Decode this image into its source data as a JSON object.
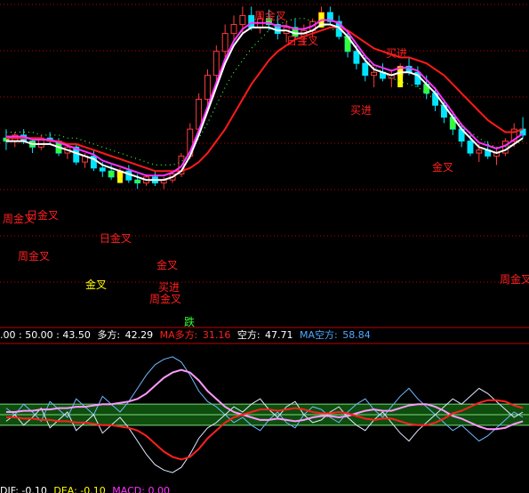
{
  "colors": {
    "background": "#000000",
    "up_candle": "#ff3b3b",
    "down_candle": "#00e5ff",
    "volume_green": "#33ff33",
    "highlight_yellow": "#ffff00",
    "ma_white": "#ffffff",
    "ma_magenta": "#ff33ff",
    "ma_red": "#ff1a1a",
    "dotted_green": "#33ff33",
    "grid_red": "#c00000",
    "label_red": "#ff2020",
    "label_yellow": "#ffff00",
    "osc_white": "#dfe8ff",
    "osc_pink": "#ff99ff",
    "osc_blue": "#6fb8ff",
    "osc_red": "#ff2020",
    "band_fill": "#0e4d0e",
    "band_line": "#7cd97c"
  },
  "signals": {
    "ri_jin_cha": "日金叉",
    "zhou_jin_cha": "周金叉",
    "mai_jin": "买进",
    "jin_cha": "金叉",
    "die": "跌"
  },
  "infobar": {
    "prefix": ".00 : 50.00 : 43.50",
    "duofang_label": "多方:",
    "duofang_value": "42.29",
    "ma_duofang_label": "MA多方:",
    "ma_duofang_value": "31.16",
    "kongfang_label": "空方:",
    "kongfang_value": "47.71",
    "ma_kongfang_label": "MA空方:",
    "ma_kongfang_value": "58.84"
  },
  "bottombar": {
    "dif": "DIF: -0.10",
    "dea": "DEA: -0.10",
    "macd": "MACD: 0.00"
  },
  "chart_data": {
    "type": "candlestick-with-indicators",
    "ylim_main": [
      0,
      100
    ],
    "ylim_osc": [
      0,
      100
    ],
    "candles": [
      [
        55,
        58,
        51,
        54
      ],
      [
        54,
        57,
        52,
        56
      ],
      [
        56,
        58,
        53,
        54
      ],
      [
        54,
        55,
        50,
        52
      ],
      [
        52,
        56,
        51,
        55
      ],
      [
        55,
        57,
        53,
        54
      ],
      [
        54,
        55,
        49,
        50
      ],
      [
        50,
        53,
        48,
        52
      ],
      [
        52,
        53,
        46,
        47
      ],
      [
        47,
        50,
        45,
        49
      ],
      [
        49,
        51,
        44,
        45
      ],
      [
        45,
        47,
        42,
        44
      ],
      [
        44,
        46,
        41,
        42
      ],
      [
        42,
        45,
        40,
        44
      ],
      [
        44,
        46,
        40,
        41
      ],
      [
        41,
        43,
        38,
        40
      ],
      [
        40,
        43,
        39,
        42
      ],
      [
        42,
        44,
        39,
        40
      ],
      [
        40,
        42,
        38,
        41
      ],
      [
        41,
        44,
        40,
        43
      ],
      [
        43,
        50,
        42,
        49
      ],
      [
        49,
        60,
        48,
        58
      ],
      [
        58,
        70,
        57,
        68
      ],
      [
        68,
        78,
        66,
        76
      ],
      [
        76,
        86,
        74,
        84
      ],
      [
        84,
        93,
        82,
        90
      ],
      [
        90,
        96,
        87,
        93
      ],
      [
        93,
        99,
        90,
        96
      ],
      [
        96,
        99,
        91,
        92
      ],
      [
        92,
        97,
        90,
        95
      ],
      [
        95,
        98,
        91,
        93
      ],
      [
        93,
        96,
        88,
        90
      ],
      [
        90,
        94,
        87,
        92
      ],
      [
        92,
        95,
        88,
        89
      ],
      [
        89,
        93,
        86,
        91
      ],
      [
        91,
        95,
        89,
        94
      ],
      [
        94,
        99,
        92,
        97
      ],
      [
        97,
        99,
        93,
        94
      ],
      [
        94,
        96,
        88,
        89
      ],
      [
        89,
        91,
        82,
        84
      ],
      [
        84,
        86,
        78,
        80
      ],
      [
        80,
        82,
        74,
        76
      ],
      [
        76,
        79,
        72,
        77
      ],
      [
        77,
        80,
        74,
        75
      ],
      [
        75,
        78,
        72,
        76
      ],
      [
        76,
        80,
        74,
        79
      ],
      [
        79,
        82,
        76,
        77
      ],
      [
        77,
        79,
        72,
        73
      ],
      [
        73,
        76,
        68,
        70
      ],
      [
        70,
        72,
        64,
        66
      ],
      [
        66,
        68,
        60,
        62
      ],
      [
        62,
        64,
        56,
        58
      ],
      [
        58,
        60,
        52,
        54
      ],
      [
        54,
        56,
        49,
        50
      ],
      [
        50,
        53,
        47,
        51
      ],
      [
        51,
        54,
        48,
        49
      ],
      [
        49,
        52,
        46,
        50
      ],
      [
        50,
        55,
        49,
        54
      ],
      [
        54,
        60,
        52,
        58
      ],
      [
        58,
        62,
        55,
        56
      ]
    ],
    "ma_fast": [
      54,
      54,
      54,
      53,
      53,
      53,
      52,
      51,
      50,
      49,
      48,
      46,
      45,
      44,
      43,
      42,
      41,
      41,
      41,
      42,
      44,
      49,
      56,
      64,
      72,
      80,
      86,
      90,
      92,
      92,
      92,
      91,
      91,
      90,
      90,
      91,
      93,
      93,
      92,
      89,
      85,
      81,
      78,
      77,
      76,
      77,
      77,
      76,
      73,
      70,
      66,
      62,
      58,
      55,
      52,
      51,
      50,
      51,
      53,
      55
    ],
    "ma_slow": [
      55,
      55,
      55,
      55,
      55,
      54,
      54,
      53,
      53,
      52,
      51,
      50,
      49,
      48,
      47,
      46,
      45,
      44,
      44,
      44,
      44,
      45,
      47,
      50,
      54,
      58,
      63,
      68,
      73,
      77,
      81,
      84,
      86,
      88,
      89,
      90,
      91,
      92,
      92,
      91,
      89,
      87,
      85,
      84,
      83,
      82,
      82,
      81,
      80,
      78,
      76,
      73,
      70,
      67,
      64,
      61,
      59,
      57,
      57,
      58
    ],
    "dotted": [
      57,
      57,
      57,
      57,
      56,
      56,
      56,
      55,
      55,
      54,
      53,
      52,
      51,
      50,
      49,
      48,
      47,
      46,
      46,
      46,
      47,
      50,
      55,
      60,
      66,
      72,
      77,
      81,
      85,
      88,
      91,
      93,
      94,
      95,
      95,
      94,
      93,
      92,
      90,
      88,
      85,
      82,
      79,
      77,
      75,
      74,
      73,
      72,
      70,
      68,
      65,
      62,
      59,
      57,
      55,
      53,
      52,
      52,
      53,
      54
    ],
    "osc_duofang": [
      45,
      50,
      42,
      48,
      55,
      40,
      46,
      52,
      38,
      44,
      50,
      36,
      42,
      48,
      40,
      30,
      20,
      12,
      8,
      6,
      10,
      20,
      32,
      40,
      44,
      50,
      56,
      52,
      58,
      62,
      54,
      48,
      56,
      60,
      50,
      44,
      46,
      52,
      56,
      48,
      42,
      38,
      46,
      52,
      44,
      36,
      30,
      38,
      44,
      50,
      56,
      62,
      58,
      64,
      70,
      66,
      60,
      54,
      48,
      52
    ],
    "osc_kongfang": [
      55,
      50,
      58,
      52,
      45,
      60,
      54,
      48,
      62,
      56,
      50,
      64,
      58,
      52,
      60,
      70,
      80,
      88,
      92,
      94,
      90,
      80,
      68,
      60,
      56,
      50,
      44,
      48,
      42,
      38,
      46,
      52,
      44,
      40,
      50,
      56,
      54,
      48,
      44,
      52,
      58,
      62,
      54,
      48,
      56,
      64,
      70,
      62,
      56,
      50,
      44,
      38,
      42,
      36,
      30,
      34,
      40,
      46,
      52,
      48
    ],
    "ma_duofang": [
      48,
      48,
      47,
      47,
      46,
      46,
      45,
      45,
      44,
      44,
      43,
      42,
      42,
      41,
      40,
      38,
      34,
      28,
      22,
      18,
      16,
      18,
      24,
      32,
      38,
      44,
      48,
      50,
      52,
      54,
      54,
      53,
      54,
      55,
      54,
      52,
      51,
      51,
      52,
      51,
      49,
      47,
      46,
      47,
      47,
      45,
      43,
      42,
      42,
      44,
      47,
      51,
      53,
      56,
      59,
      61,
      61,
      60,
      57,
      55
    ],
    "ma_kongfang": [
      52,
      52,
      53,
      53,
      54,
      54,
      55,
      55,
      56,
      56,
      57,
      58,
      58,
      59,
      60,
      62,
      66,
      72,
      78,
      82,
      84,
      82,
      76,
      68,
      62,
      56,
      52,
      50,
      48,
      46,
      46,
      47,
      46,
      45,
      46,
      48,
      49,
      49,
      48,
      49,
      51,
      53,
      54,
      53,
      53,
      55,
      57,
      58,
      58,
      56,
      53,
      49,
      47,
      44,
      41,
      39,
      39,
      40,
      43,
      45
    ]
  }
}
